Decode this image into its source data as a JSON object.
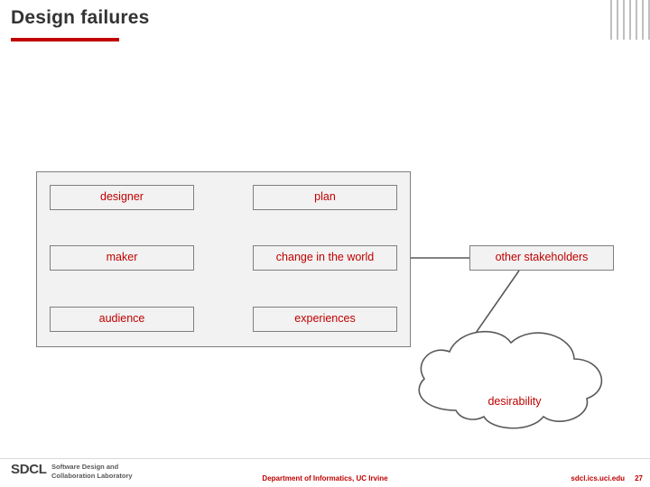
{
  "slide": {
    "title": "Design failures",
    "accent_color": "#c00000",
    "node_text_color": "#c00000",
    "node_fill": "#f2f2f2",
    "node_border": "#7f7f7f"
  },
  "diagram": {
    "nodes": [
      {
        "id": "designer",
        "label": "designer"
      },
      {
        "id": "maker",
        "label": "maker"
      },
      {
        "id": "audience",
        "label": "audience"
      },
      {
        "id": "plan",
        "label": "plan"
      },
      {
        "id": "change",
        "label": "change in the world"
      },
      {
        "id": "experiences",
        "label": "experiences"
      },
      {
        "id": "stakeholders",
        "label": "other stakeholders"
      }
    ],
    "cloud": {
      "label": "desirability"
    },
    "edges": [
      {
        "from": "designer",
        "to": "plan",
        "arrow": true
      },
      {
        "from": "maker",
        "to": "change",
        "arrow": true
      },
      {
        "from": "audience",
        "to": "experiences",
        "arrow": true
      },
      {
        "from": "plan",
        "to": "maker",
        "arrow": true
      },
      {
        "from": "experiences",
        "to": "maker",
        "arrow": true
      },
      {
        "from": "change",
        "to": "stakeholders",
        "arrow": false
      },
      {
        "from": "stakeholders",
        "to": "cloud",
        "arrow": false
      }
    ]
  },
  "footer": {
    "brand": "SDCL",
    "lab_line1": "Software Design and",
    "lab_line2": "Collaboration Laboratory",
    "center": "Department of Informatics, UC Irvine",
    "url": "sdcl.ics.uci.edu",
    "page": "27"
  }
}
